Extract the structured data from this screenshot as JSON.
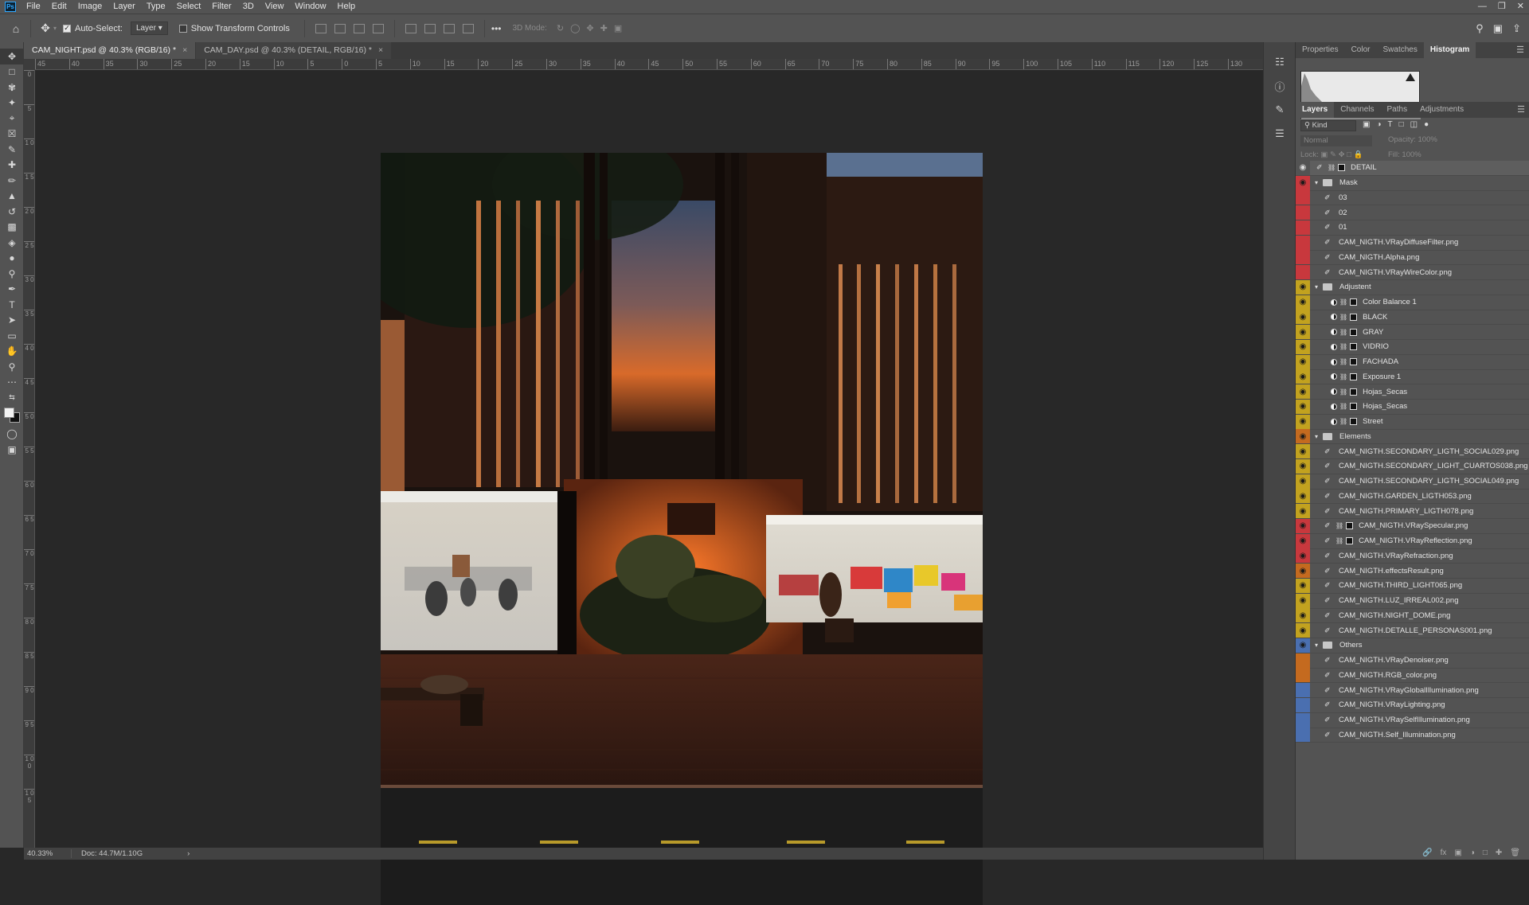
{
  "menubar": {
    "app_icon": "Ps",
    "items": [
      "File",
      "Edit",
      "Image",
      "Layer",
      "Type",
      "Select",
      "Filter",
      "3D",
      "View",
      "Window",
      "Help"
    ]
  },
  "options": {
    "auto_select_label": "Auto-Select:",
    "auto_select_checked": true,
    "auto_select_value": "Layer",
    "transform_label": "Show Transform Controls",
    "more": "•••",
    "mode3d_label": "3D Mode:"
  },
  "tabs": [
    {
      "label": "CAM_NIGHT.psd @ 40.3% (RGB/16) *",
      "active": true
    },
    {
      "label": "CAM_DAY.psd @ 40.3% (DETAIL, RGB/16) *",
      "active": false
    }
  ],
  "ruler_top": [
    "45",
    "40",
    "35",
    "30",
    "25",
    "20",
    "15",
    "10",
    "5",
    "0",
    "5",
    "10",
    "15",
    "20",
    "25",
    "30",
    "35",
    "40",
    "45",
    "50",
    "55",
    "60",
    "65",
    "70",
    "75",
    "80",
    "85",
    "90",
    "95",
    "100",
    "105",
    "110",
    "115",
    "120",
    "125",
    "130"
  ],
  "ruler_left": [
    "0",
    "5",
    "1 0",
    "1 5",
    "2 0",
    "2 5",
    "3 0",
    "3 5",
    "4 0",
    "4 5",
    "5 0",
    "5 5",
    "6 0",
    "6 5",
    "7 0",
    "7 5",
    "8 0",
    "8 5",
    "9 0",
    "9 5",
    "1 0 0",
    "1 0 5"
  ],
  "status": {
    "zoom": "40.33%",
    "doc": "Doc: 44.7M/1.10G",
    "arrow": "›"
  },
  "top_panel_tabs": [
    "Properties",
    "Color",
    "Swatches",
    "Histogram"
  ],
  "top_panel_active": "Histogram",
  "layer_panel_tabs": [
    "Layers",
    "Channels",
    "Paths",
    "Adjustments"
  ],
  "layer_panel_active": "Layers",
  "layers_controls": {
    "filter_kind": "Kind",
    "blend_mode": "Normal",
    "opacity_label": "Opacity:",
    "opacity_value": "100%",
    "lock_label": "Lock:",
    "fill_label": "Fill:",
    "fill_value": "100%"
  },
  "colors": {
    "red": "#c8383d",
    "yellow": "#c2a21f",
    "orange": "#c46a1f",
    "blue": "#4a6fb0",
    "selected": "#535353"
  },
  "layers": [
    {
      "name": "DETAIL",
      "type": "smart",
      "color": "none",
      "visible": true,
      "indent": 0
    },
    {
      "name": "Mask",
      "type": "group",
      "color": "red",
      "visible": true,
      "indent": 0
    },
    {
      "name": "03",
      "type": "pixel",
      "color": "red",
      "visible": false,
      "indent": 1
    },
    {
      "name": "02",
      "type": "pixel",
      "color": "red",
      "visible": false,
      "indent": 1
    },
    {
      "name": "01",
      "type": "pixel",
      "color": "red",
      "visible": false,
      "indent": 1
    },
    {
      "name": "CAM_NIGTH.VRayDiffuseFilter.png",
      "type": "pixel",
      "color": "red",
      "visible": false,
      "indent": 1
    },
    {
      "name": "CAM_NIGTH.Alpha.png",
      "type": "pixel",
      "color": "red",
      "visible": false,
      "indent": 1
    },
    {
      "name": "CAM_NIGTH.VRayWireColor.png",
      "type": "pixel",
      "color": "red",
      "visible": false,
      "indent": 1
    },
    {
      "name": "Adjustent",
      "type": "group",
      "color": "yellow",
      "visible": true,
      "indent": 0
    },
    {
      "name": "Color Balance 1",
      "type": "adjust",
      "color": "yellow",
      "visible": true,
      "indent": 1
    },
    {
      "name": "BLACK",
      "type": "adjust",
      "color": "yellow",
      "visible": true,
      "indent": 1
    },
    {
      "name": "GRAY",
      "type": "adjust",
      "color": "yellow",
      "visible": true,
      "indent": 1
    },
    {
      "name": "VIDRIO",
      "type": "adjust",
      "color": "yellow",
      "visible": true,
      "indent": 1
    },
    {
      "name": "FACHADA",
      "type": "adjust",
      "color": "yellow",
      "visible": true,
      "indent": 1
    },
    {
      "name": "Exposure 1",
      "type": "adjust",
      "color": "yellow",
      "visible": true,
      "indent": 1
    },
    {
      "name": "Hojas_Secas",
      "type": "adjust",
      "color": "yellow",
      "visible": true,
      "indent": 1
    },
    {
      "name": "Hojas_Secas",
      "type": "adjust",
      "color": "yellow",
      "visible": true,
      "indent": 1
    },
    {
      "name": "Street",
      "type": "adjust",
      "color": "yellow",
      "visible": true,
      "indent": 1
    },
    {
      "name": "Elements",
      "type": "group",
      "color": "orange",
      "visible": true,
      "indent": 0
    },
    {
      "name": "CAM_NIGTH.SECONDARY_LIGTH_SOCIAL029.png",
      "type": "pixel",
      "color": "yellow",
      "visible": true,
      "indent": 1
    },
    {
      "name": "CAM_NIGTH.SECONDARY_LIGHT_CUARTOS038.png",
      "type": "pixel",
      "color": "yellow",
      "visible": true,
      "indent": 1
    },
    {
      "name": "CAM_NIGTH.SECONDARY_LIGTH_SOCIAL049.png",
      "type": "pixel",
      "color": "yellow",
      "visible": true,
      "indent": 1
    },
    {
      "name": "CAM_NIGTH.GARDEN_LIGTH053.png",
      "type": "pixel",
      "color": "yellow",
      "visible": true,
      "indent": 1
    },
    {
      "name": "CAM_NIGTH.PRIMARY_LIGTH078.png",
      "type": "pixel",
      "color": "yellow",
      "visible": true,
      "indent": 1
    },
    {
      "name": "CAM_NIGTH.VRaySpecular.png",
      "type": "masked",
      "color": "red",
      "visible": true,
      "indent": 1
    },
    {
      "name": "CAM_NIGTH.VRayReflection.png",
      "type": "masked",
      "color": "red",
      "visible": true,
      "indent": 1
    },
    {
      "name": "CAM_NIGTH.VRayRefraction.png",
      "type": "pixel",
      "color": "red",
      "visible": true,
      "indent": 1
    },
    {
      "name": "CAM_NIGTH.effectsResult.png",
      "type": "pixel",
      "color": "orange",
      "visible": true,
      "indent": 1
    },
    {
      "name": "CAM_NIGTH.THIRD_LIGHT065.png",
      "type": "pixel",
      "color": "yellow",
      "visible": true,
      "indent": 1
    },
    {
      "name": "CAM_NIGTH.LUZ_IRREAL002.png",
      "type": "pixel",
      "color": "yellow",
      "visible": true,
      "indent": 1
    },
    {
      "name": "CAM_NIGTH.NIGHT_DOME.png",
      "type": "pixel",
      "color": "yellow",
      "visible": true,
      "indent": 1
    },
    {
      "name": "CAM_NIGTH.DETALLE_PERSONAS001.png",
      "type": "pixel",
      "color": "yellow",
      "visible": true,
      "indent": 1
    },
    {
      "name": "Others",
      "type": "group",
      "color": "blue",
      "visible": true,
      "indent": 0
    },
    {
      "name": "CAM_NIGTH.VRayDenoiser.png",
      "type": "pixel",
      "color": "orange",
      "visible": false,
      "indent": 1
    },
    {
      "name": "CAM_NIGTH.RGB_color.png",
      "type": "pixel",
      "color": "orange",
      "visible": false,
      "indent": 1
    },
    {
      "name": "CAM_NIGTH.VRayGlobalIllumination.png",
      "type": "pixel",
      "color": "blue",
      "visible": false,
      "indent": 1
    },
    {
      "name": "CAM_NIGTH.VRayLighting.png",
      "type": "pixel",
      "color": "blue",
      "visible": false,
      "indent": 1
    },
    {
      "name": "CAM_NIGTH.VRaySelfIllumination.png",
      "type": "pixel",
      "color": "blue",
      "visible": false,
      "indent": 1
    },
    {
      "name": "CAM_NIGTH.Self_Illumination.png",
      "type": "pixel",
      "color": "blue",
      "visible": false,
      "indent": 1
    }
  ]
}
